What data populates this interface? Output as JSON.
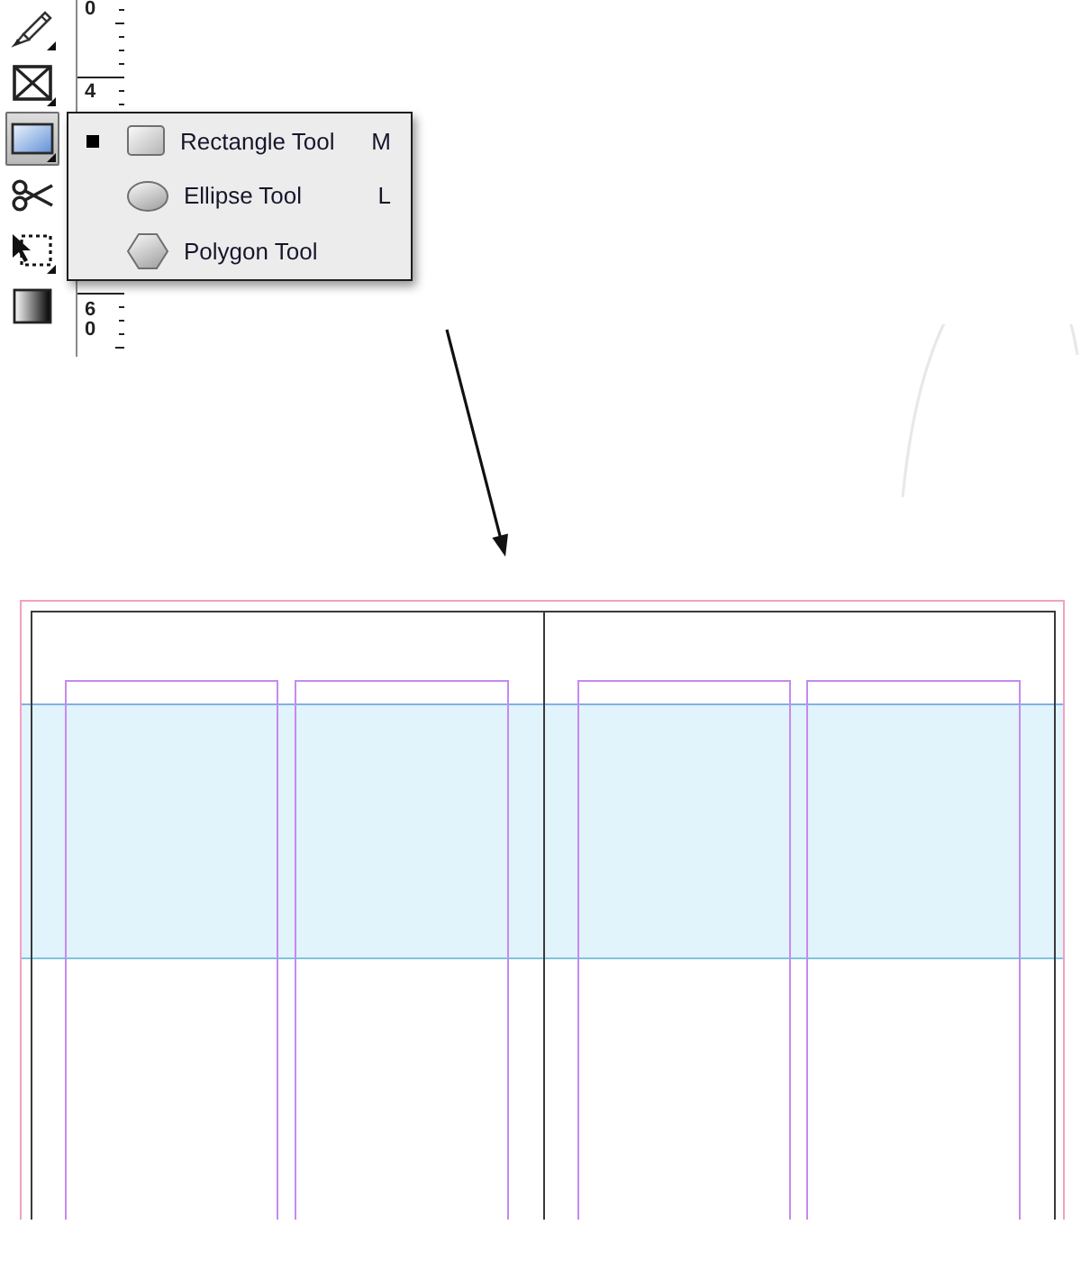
{
  "toolbar": {
    "tools": [
      {
        "kind": "pencil",
        "selected": false,
        "flyout": true
      },
      {
        "kind": "frame",
        "selected": false,
        "flyout": true
      },
      {
        "kind": "rectangle",
        "selected": true,
        "flyout": true
      },
      {
        "kind": "scissors",
        "selected": false,
        "flyout": false
      },
      {
        "kind": "transform",
        "selected": false,
        "flyout": true
      },
      {
        "kind": "gradient",
        "selected": false,
        "flyout": false
      }
    ]
  },
  "ruler": {
    "labels": [
      "0",
      "4",
      "60"
    ]
  },
  "flyout_menu": {
    "items": [
      {
        "kind": "rectangle",
        "label": "Rectangle Tool",
        "shortcut": "M",
        "selected": true
      },
      {
        "kind": "ellipse",
        "label": "Ellipse Tool",
        "shortcut": "L",
        "selected": false
      },
      {
        "kind": "polygon",
        "label": "Polygon Tool",
        "selected": false
      }
    ]
  }
}
